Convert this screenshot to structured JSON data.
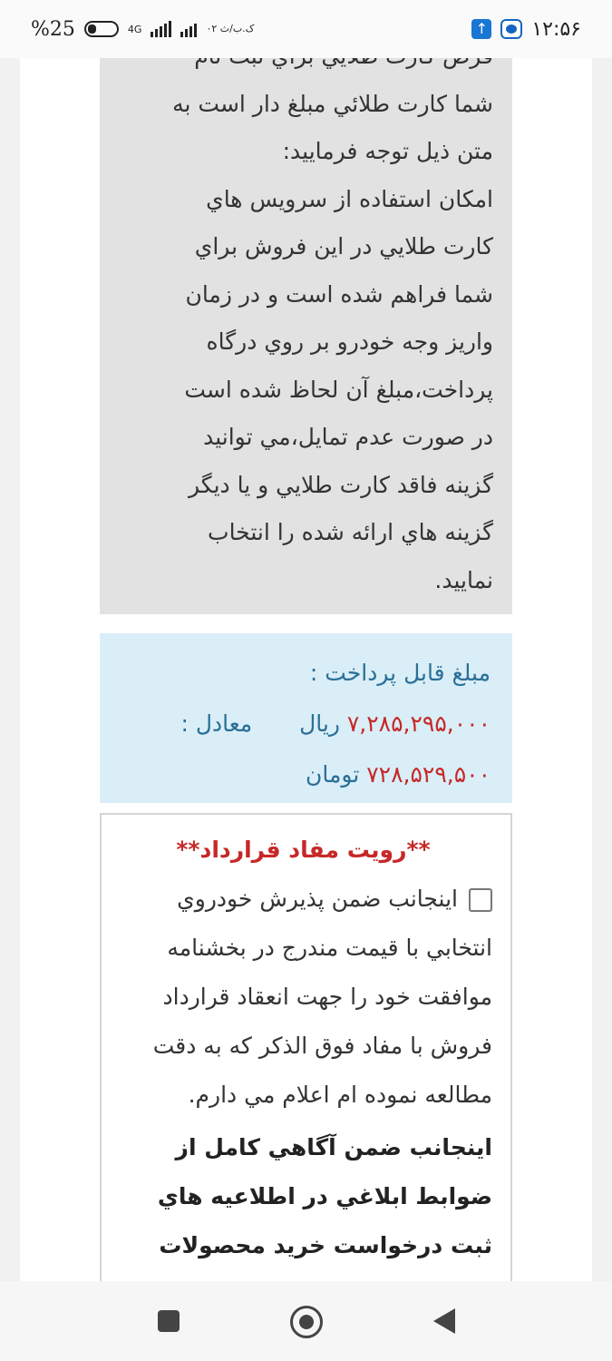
{
  "status_bar": {
    "battery": "%25",
    "network": "4G",
    "carrier": "۰۲ ک.ب/ث",
    "time": "۱۲:۵۶"
  },
  "gold_card_notice": {
    "lines": [
      "فرض كارت طلايي براي ثبت نام",
      "شما كارت طلائي مبلغ دار است به",
      "متن ذيل توجه فرماييد:",
      "امكان استفاده از سرويس هاي",
      "كارت طلايي در اين فروش براي",
      "شما فراهم شده است و در زمان",
      "واريز وجه خودرو بر روي درگاه",
      "پرداخت،مبلغ آن لحاظ شده است",
      "در صورت عدم تمايل،مي توانيد",
      "گزينه فاقد كارت طلايي و يا ديگر",
      "گزينه هاي ارائه شده را انتخاب",
      "نماييد."
    ]
  },
  "payment": {
    "label": "مبلغ قابل پرداخت :",
    "rial_amount": "۷,۲۸۵,۲۹۵,۰۰۰",
    "rial_unit": "ريال",
    "equal_label": "معادل :",
    "toman_amount": "۷۲۸,۵۲۹,۵۰۰",
    "toman_unit": "تومان"
  },
  "contract": {
    "title": "**رويت مفاد قرارداد**",
    "agreement_text": "اينجانب ضمن پذيرش خودروي انتخابي با قيمت مندرج در بخشنامه موافقت خود را جهت انعقاد قرارداد فروش با مفاد فوق الذكر كه به دقت مطالعه نموده ام اعلام مي دارم.",
    "agreement_checked": false,
    "awareness_text": "اينجانب ضمن آگاهي كامل از ضوابط ابلاغي در اطلاعيه هاي ثبت درخواست خريد محصولات ايران"
  },
  "nav": {
    "recents": "square-icon",
    "home": "home-circle-icon",
    "back": "back-triangle-icon"
  }
}
